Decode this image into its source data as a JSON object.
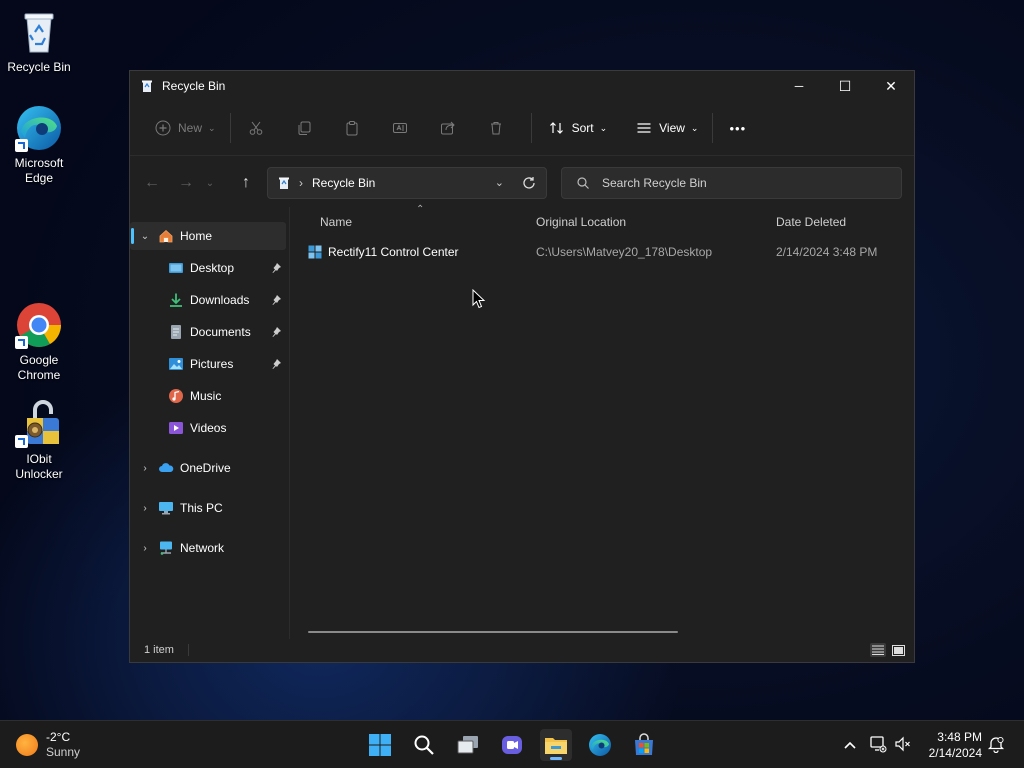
{
  "desktop": {
    "icons": [
      {
        "label": "Recycle Bin",
        "icon": "recycle-bin-icon"
      },
      {
        "label": "Microsoft Edge",
        "icon": "edge-icon"
      },
      {
        "label": "Google Chrome",
        "icon": "chrome-icon"
      },
      {
        "label": "IObit Unlocker",
        "icon": "iobit-unlocker-icon"
      }
    ]
  },
  "window": {
    "title": "Recycle Bin",
    "controls": {
      "minimize": "─",
      "maximize": "☐",
      "close": "✕"
    }
  },
  "toolbar": {
    "new_label": "New",
    "sort_label": "Sort",
    "view_label": "View",
    "more_label": "•••"
  },
  "address": {
    "breadcrumb_sep": "›",
    "location": "Recycle Bin"
  },
  "search": {
    "placeholder": "Search Recycle Bin"
  },
  "sidebar": {
    "home": "Home",
    "quick_access": [
      {
        "label": "Desktop",
        "pinned": true
      },
      {
        "label": "Downloads",
        "pinned": true
      },
      {
        "label": "Documents",
        "pinned": true
      },
      {
        "label": "Pictures",
        "pinned": true
      },
      {
        "label": "Music",
        "pinned": false
      },
      {
        "label": "Videos",
        "pinned": false
      }
    ],
    "onedrive": "OneDrive",
    "this_pc": "This PC",
    "network": "Network"
  },
  "columns": {
    "name": "Name",
    "original_location": "Original Location",
    "date_deleted": "Date Deleted"
  },
  "files": [
    {
      "name": "Rectify11 Control Center",
      "original_location": "C:\\Users\\Matvey20_178\\Desktop",
      "date_deleted": "2/14/2024 3:48 PM"
    }
  ],
  "status": {
    "item_count": "1 item"
  },
  "taskbar": {
    "weather_temp": "-2°C",
    "weather_desc": "Sunny",
    "time": "3:48 PM",
    "date": "2/14/2024"
  },
  "colors": {
    "accent": "#4cc2ff",
    "window_bg": "#202020",
    "taskbar_bg": "#1c1c1c"
  }
}
